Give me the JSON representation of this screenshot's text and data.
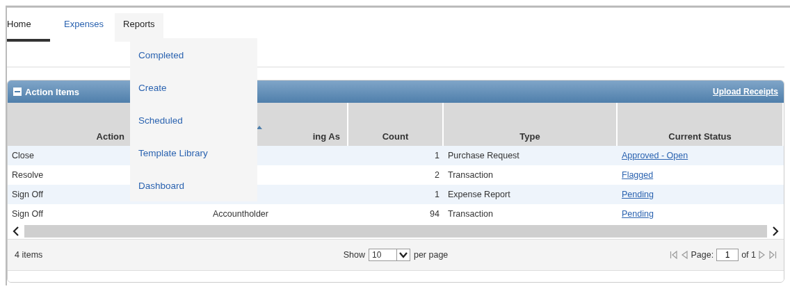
{
  "nav": {
    "tabs": [
      {
        "label": "Home",
        "selected": true,
        "expanded": false
      },
      {
        "label": "Expenses",
        "selected": false,
        "expanded": false
      },
      {
        "label": "Reports",
        "selected": false,
        "expanded": true
      }
    ]
  },
  "reports_menu": {
    "items": [
      "Completed",
      "Create",
      "Scheduled",
      "Template Library",
      "Dashboard"
    ]
  },
  "panel": {
    "title": "Action Items",
    "expanded": true,
    "link": "Upload Receipts"
  },
  "table": {
    "columns": [
      {
        "label": "Action",
        "sorted": false
      },
      {
        "label": "ing As",
        "sorted": true
      },
      {
        "label": "Count",
        "sorted": false
      },
      {
        "label": "Type",
        "sorted": false
      },
      {
        "label": "Current Status",
        "sorted": false
      }
    ],
    "rows": [
      {
        "action": "Close",
        "count": "1",
        "type": "Purchase Request",
        "status": "Approved - Open"
      },
      {
        "action": "Resolve",
        "count": "2",
        "type": "Transaction",
        "status": "Flagged"
      },
      {
        "action": "Sign Off",
        "count": "1",
        "type": "Expense Report",
        "status": "Pending"
      },
      {
        "action": "Sign Off",
        "column_2": "Accountholder",
        "count": "94",
        "type": "Transaction",
        "status": "Pending"
      }
    ]
  },
  "footer": {
    "count": "4 items",
    "show_label": "Show",
    "page_size": "10",
    "per_page_label": "per page",
    "page_label": "Page:",
    "page": "1",
    "of_label": "of 1"
  }
}
